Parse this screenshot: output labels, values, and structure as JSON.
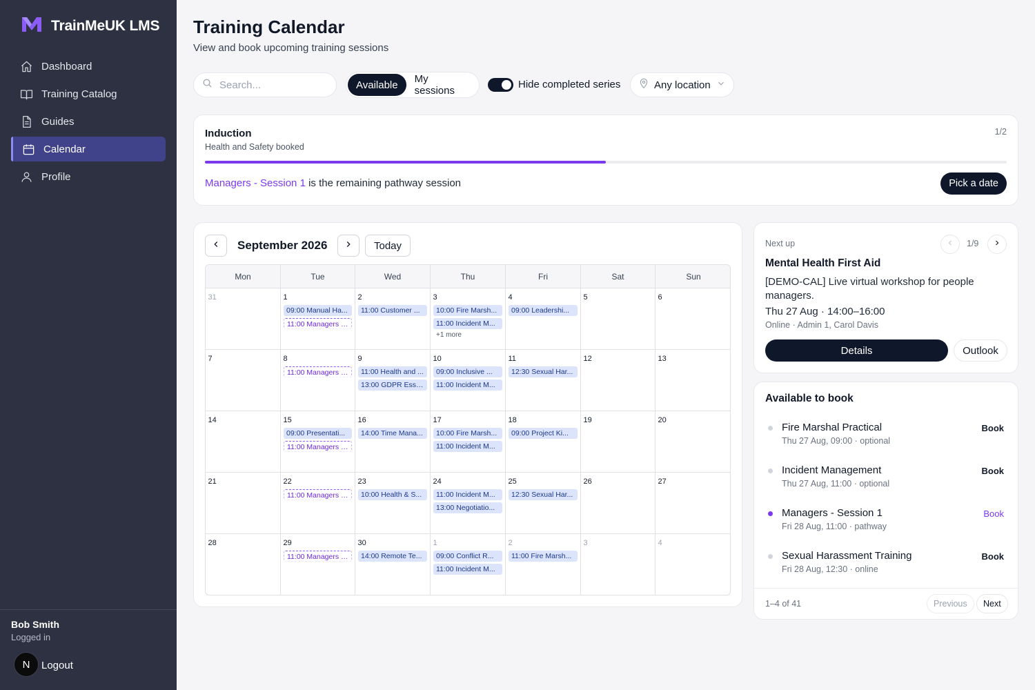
{
  "app": {
    "name": "TrainMeUK LMS"
  },
  "sidebar": {
    "items": [
      {
        "label": "Dashboard",
        "icon": "home-icon"
      },
      {
        "label": "Training Catalog",
        "icon": "book-open-icon"
      },
      {
        "label": "Guides",
        "icon": "document-icon"
      },
      {
        "label": "Calendar",
        "icon": "calendar-icon",
        "active": true
      },
      {
        "label": "Profile",
        "icon": "user-icon"
      }
    ],
    "user": {
      "name": "Bob Smith",
      "status": "Logged in",
      "avatar_letter": "N"
    },
    "logout": "Logout"
  },
  "header": {
    "title": "Training Calendar",
    "subtitle": "View and book upcoming training sessions"
  },
  "toolbar": {
    "search_placeholder": "Search...",
    "seg_available": "Available",
    "seg_mine": "My sessions",
    "toggle_label": "Hide completed series",
    "toggle_on": true,
    "location": "Any location"
  },
  "pathway": {
    "title": "Induction",
    "subtitle": "Health and Safety booked",
    "count": "1/2",
    "progress": 0.5,
    "session_link": "Managers - Session 1",
    "message": " is the remaining pathway session",
    "action": "Pick a date"
  },
  "calendar": {
    "month": "September 2026",
    "today": "Today",
    "weekdays": [
      "Mon",
      "Tue",
      "Wed",
      "Thu",
      "Fri",
      "Sat",
      "Sun"
    ],
    "weeks": [
      [
        {
          "n": "31",
          "muted": true,
          "events": []
        },
        {
          "n": "1",
          "events": [
            {
              "t": "09:00 Manual Ha...",
              "k": "std"
            },
            {
              "t": "11:00 Managers -...",
              "k": "pw"
            }
          ]
        },
        {
          "n": "2",
          "events": [
            {
              "t": "11:00 Customer ...",
              "k": "std"
            }
          ]
        },
        {
          "n": "3",
          "events": [
            {
              "t": "10:00 Fire Marsh...",
              "k": "std"
            },
            {
              "t": "11:00 Incident M...",
              "k": "std"
            }
          ],
          "more": "+1 more"
        },
        {
          "n": "4",
          "events": [
            {
              "t": "09:00 Leadershi...",
              "k": "std"
            }
          ]
        },
        {
          "n": "5",
          "events": []
        },
        {
          "n": "6",
          "events": []
        }
      ],
      [
        {
          "n": "7",
          "events": []
        },
        {
          "n": "8",
          "events": [
            {
              "t": "11:00 Managers -...",
              "k": "pw"
            }
          ]
        },
        {
          "n": "9",
          "events": [
            {
              "t": "11:00 Health and ...",
              "k": "std"
            },
            {
              "t": "13:00 GDPR Esse...",
              "k": "std"
            }
          ]
        },
        {
          "n": "10",
          "events": [
            {
              "t": "09:00 Inclusive ...",
              "k": "std"
            },
            {
              "t": "11:00 Incident M...",
              "k": "std"
            }
          ]
        },
        {
          "n": "11",
          "events": [
            {
              "t": "12:30 Sexual Har...",
              "k": "std"
            }
          ]
        },
        {
          "n": "12",
          "events": []
        },
        {
          "n": "13",
          "events": []
        }
      ],
      [
        {
          "n": "14",
          "events": []
        },
        {
          "n": "15",
          "events": [
            {
              "t": "09:00 Presentati...",
              "k": "std"
            },
            {
              "t": "11:00 Managers -...",
              "k": "pw"
            }
          ]
        },
        {
          "n": "16",
          "events": [
            {
              "t": "14:00 Time Mana...",
              "k": "std"
            }
          ]
        },
        {
          "n": "17",
          "events": [
            {
              "t": "10:00 Fire Marsh...",
              "k": "std"
            },
            {
              "t": "11:00 Incident M...",
              "k": "std"
            }
          ]
        },
        {
          "n": "18",
          "events": [
            {
              "t": "09:00 Project Ki...",
              "k": "std"
            }
          ]
        },
        {
          "n": "19",
          "events": []
        },
        {
          "n": "20",
          "events": []
        }
      ],
      [
        {
          "n": "21",
          "events": []
        },
        {
          "n": "22",
          "events": [
            {
              "t": "11:00 Managers -...",
              "k": "pw"
            }
          ]
        },
        {
          "n": "23",
          "events": [
            {
              "t": "10:00 Health & S...",
              "k": "std"
            }
          ]
        },
        {
          "n": "24",
          "events": [
            {
              "t": "11:00 Incident M...",
              "k": "std"
            },
            {
              "t": "13:00 Negotiatio...",
              "k": "std"
            }
          ]
        },
        {
          "n": "25",
          "events": [
            {
              "t": "12:30 Sexual Har...",
              "k": "std"
            }
          ]
        },
        {
          "n": "26",
          "events": []
        },
        {
          "n": "27",
          "events": []
        }
      ],
      [
        {
          "n": "28",
          "events": []
        },
        {
          "n": "29",
          "events": [
            {
              "t": "11:00 Managers -...",
              "k": "pw"
            }
          ]
        },
        {
          "n": "30",
          "events": [
            {
              "t": "14:00 Remote Te...",
              "k": "std"
            }
          ]
        },
        {
          "n": "1",
          "muted": true,
          "events": [
            {
              "t": "09:00 Conflict R...",
              "k": "std"
            },
            {
              "t": "11:00 Incident M...",
              "k": "std"
            }
          ]
        },
        {
          "n": "2",
          "muted": true,
          "events": [
            {
              "t": "11:00 Fire Marsh...",
              "k": "std"
            }
          ]
        },
        {
          "n": "3",
          "muted": true,
          "events": []
        },
        {
          "n": "4",
          "muted": true,
          "events": []
        }
      ]
    ]
  },
  "next_up": {
    "label": "Next up",
    "count": "1/9",
    "title": "Mental Health First Aid",
    "description": "[DEMO-CAL] Live virtual workshop for people managers.",
    "when": "Thu 27 Aug · 14:00–16:00",
    "where": "Online · Admin 1, Carol Davis",
    "details": "Details",
    "outlook": "Outlook"
  },
  "available": {
    "title": "Available to book",
    "items": [
      {
        "name": "Fire Marshal Practical",
        "meta": "Thu 27 Aug, 09:00 · optional",
        "action": "Book",
        "pathway": false
      },
      {
        "name": "Incident Management",
        "meta": "Thu 27 Aug, 11:00 · optional",
        "action": "Book",
        "pathway": false
      },
      {
        "name": "Managers - Session 1",
        "meta": "Fri 28 Aug, 11:00 · pathway",
        "action": "Book",
        "pathway": true
      },
      {
        "name": "Sexual Harassment Training",
        "meta": "Fri 28 Aug, 12:30 · online",
        "action": "Book",
        "pathway": false
      }
    ],
    "range": "1–4 of 41",
    "previous": "Previous",
    "next": "Next"
  }
}
